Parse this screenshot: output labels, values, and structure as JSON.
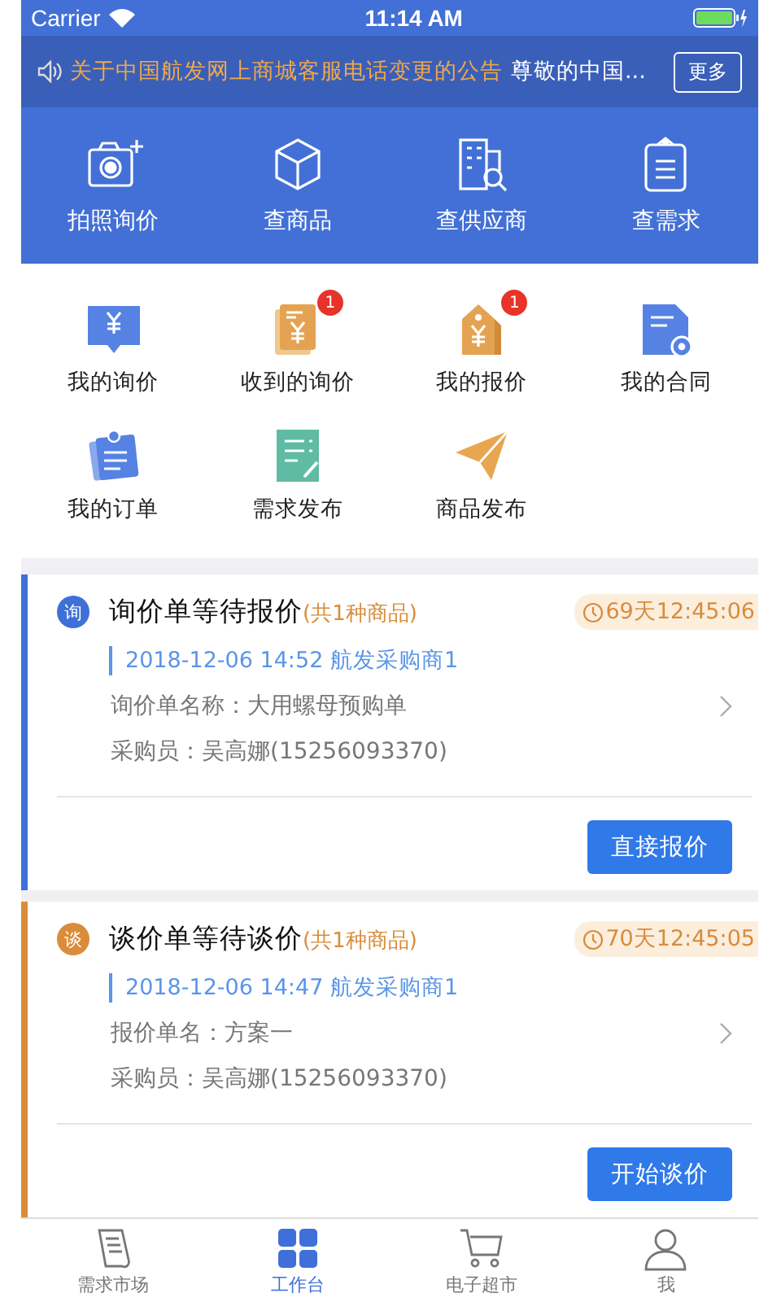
{
  "status_bar": {
    "carrier": "Carrier",
    "time": "11:14 AM"
  },
  "notice": {
    "title": "关于中国航发网上商城客服电话变更的公告",
    "body": "尊敬的中国...",
    "more": "更多"
  },
  "quick_actions": [
    {
      "label": "拍照询价",
      "kind": "camera"
    },
    {
      "label": "查商品",
      "kind": "box"
    },
    {
      "label": "查供应商",
      "kind": "building"
    },
    {
      "label": "查需求",
      "kind": "clipboard"
    }
  ],
  "shortcuts": [
    {
      "label": "我的询价",
      "kind": "inquiry"
    },
    {
      "label": "收到的询价",
      "kind": "received",
      "badge": "1"
    },
    {
      "label": "我的报价",
      "kind": "tag",
      "badge": "1"
    },
    {
      "label": "我的合同",
      "kind": "contract"
    },
    {
      "label": "我的订单",
      "kind": "order"
    },
    {
      "label": "需求发布",
      "kind": "publish"
    },
    {
      "label": "商品发布",
      "kind": "plane"
    }
  ],
  "cards": [
    {
      "color": "#3f6fd8",
      "badge": "询",
      "title": "询价单等待报价",
      "count": "(共1种商品)",
      "timer": "69天12:45:06",
      "meta": "2018-12-06 14:52 航发采购商1",
      "lines": [
        "询价单名称：大用螺母预购单",
        "采购员：吴高娜(15256093370)"
      ],
      "action": "直接报价"
    },
    {
      "color": "#d98c3a",
      "badge": "谈",
      "title": "谈价单等待谈价",
      "count": "(共1种商品)",
      "timer": "70天12:45:05",
      "meta": "2018-12-06 14:47 航发采购商1",
      "lines": [
        "报价单名：方案一",
        "采购员：吴高娜(15256093370)"
      ],
      "action": "开始谈价"
    }
  ],
  "tab_bar": [
    {
      "label": "需求市场",
      "kind": "document",
      "selected": false
    },
    {
      "label": "工作台",
      "kind": "grid",
      "selected": true
    },
    {
      "label": "电子超市",
      "kind": "cart",
      "selected": false
    },
    {
      "label": "我",
      "kind": "person",
      "selected": false
    }
  ]
}
